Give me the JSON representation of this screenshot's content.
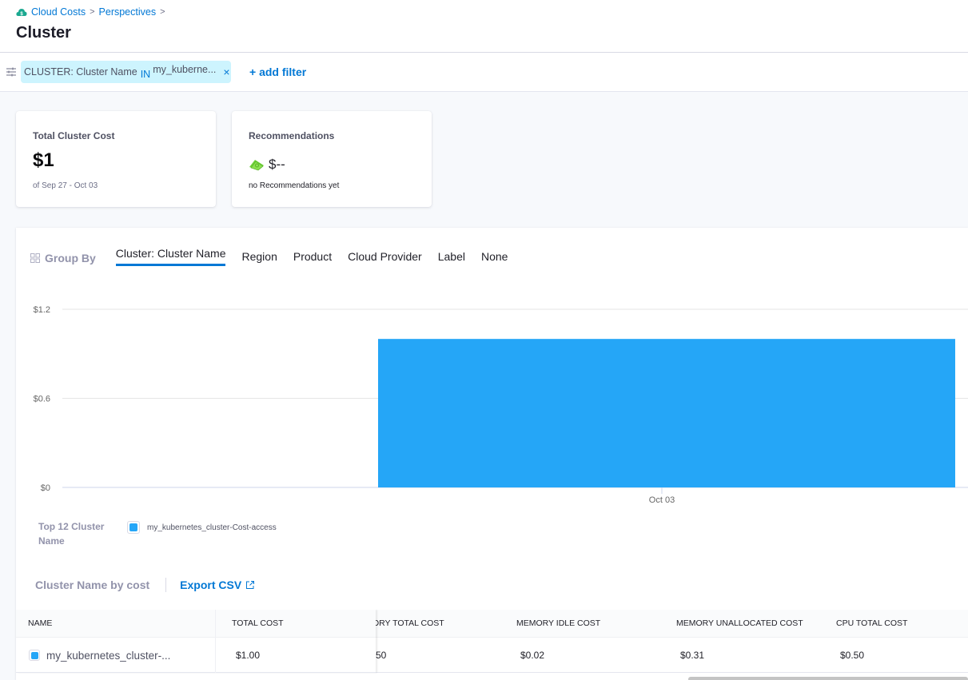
{
  "breadcrumb": {
    "items": [
      "Cloud Costs",
      "Perspectives"
    ],
    "separator": ">"
  },
  "page_title": "Cluster",
  "filter": {
    "field": "CLUSTER: Cluster Name",
    "operator": "IN",
    "value": "my_kuberne...",
    "remove_icon": "×",
    "add_filter_label": "+ add filter"
  },
  "cards": {
    "total": {
      "title": "Total Cluster Cost",
      "value": "$1",
      "subtitle": "of Sep 27 - Oct 03"
    },
    "recommendations": {
      "title": "Recommendations",
      "value": "$--",
      "subtitle": "no Recommendations yet"
    }
  },
  "group_by": {
    "label": "Group By",
    "options": [
      "Cluster: Cluster Name",
      "Region",
      "Product",
      "Cloud Provider",
      "Label",
      "None"
    ],
    "active": "Cluster: Cluster Name"
  },
  "chart_data": {
    "type": "bar",
    "title": "",
    "xlabel": "",
    "ylabel": "",
    "categories": [
      "Oct 03"
    ],
    "series": [
      {
        "name": "my_kubernetes_cluster-Cost-access",
        "values": [
          1.0
        ],
        "color": "#25a6f7"
      }
    ],
    "yticks": [
      "$0",
      "$0.6",
      "$1.2"
    ],
    "ytick_values": [
      0,
      0.6,
      1.2
    ],
    "ylim": [
      0,
      1.2
    ],
    "grid": true,
    "legend_title": "Top 12 Cluster Name",
    "legend_position": "bottom-left"
  },
  "table": {
    "title": "Cluster Name by cost",
    "export_label": "Export CSV",
    "columns": [
      "NAME",
      "TOTAL COST",
      "MEMORY TOTAL COST",
      "MEMORY IDLE COST",
      "MEMORY UNALLOCATED COST",
      "CPU TOTAL COST"
    ],
    "visible_partial_header": "ORY TOTAL COST",
    "rows": [
      {
        "name": "my_kubernetes_cluster-...",
        "total_cost": "$1.00",
        "memory_total_cost_partial": "50",
        "memory_idle_cost": "$0.02",
        "memory_unallocated_cost": "$0.31",
        "cpu_total_cost": "$0.50",
        "color": "#25a6f7"
      }
    ]
  },
  "colors": {
    "accent": "#0278d5",
    "series": "#25a6f7",
    "filter_pill_bg": "#cdf4fe"
  }
}
